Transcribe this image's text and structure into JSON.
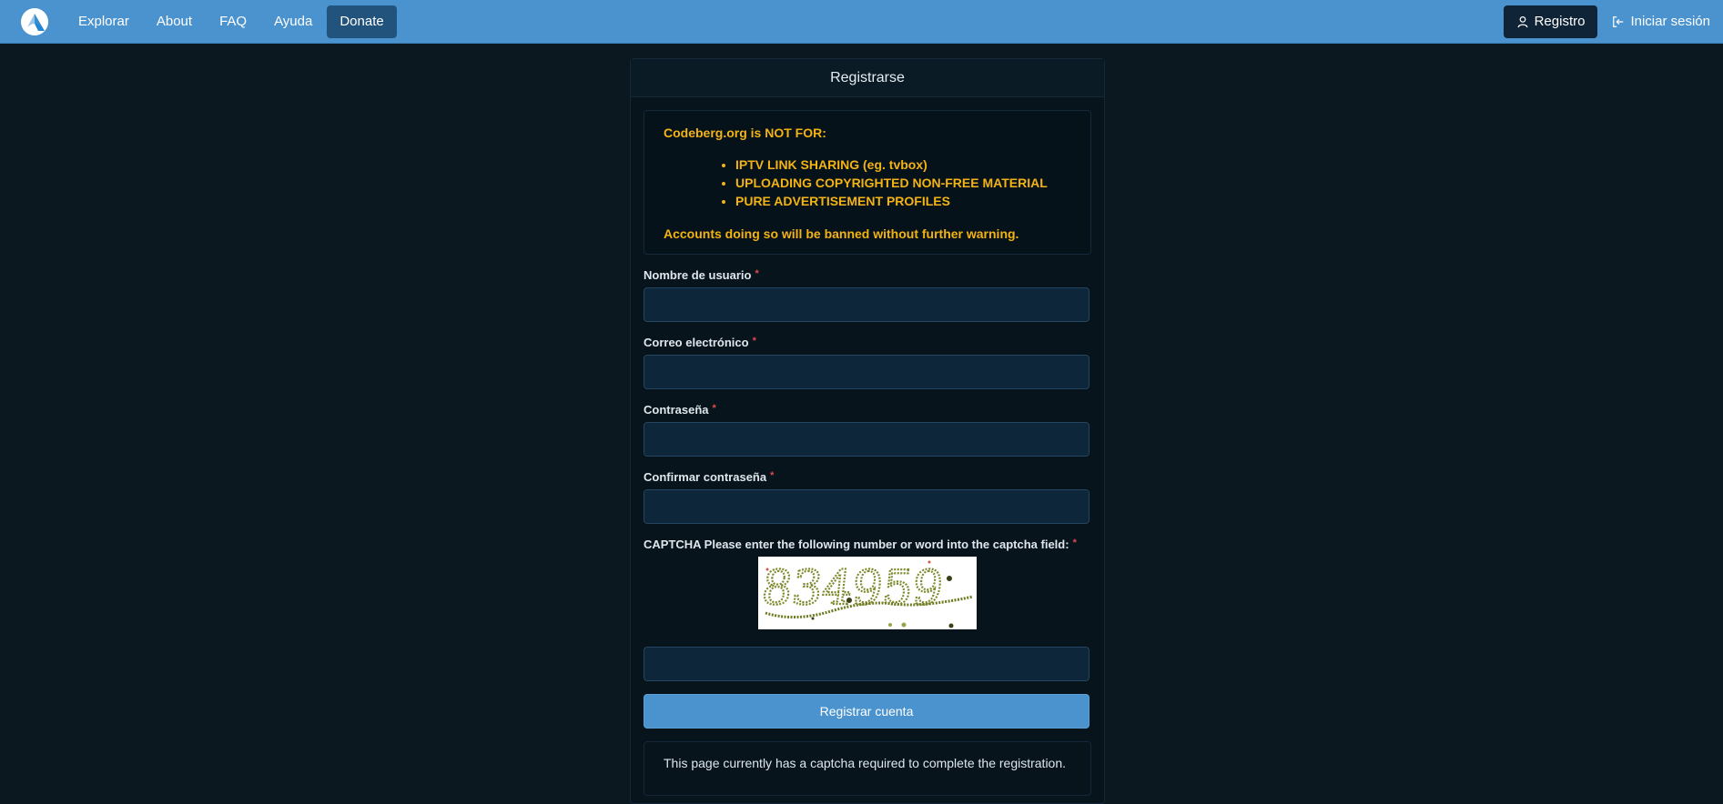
{
  "nav": {
    "logo_icon": "codeberg-mountain-icon",
    "items": [
      {
        "label": "Explorar"
      },
      {
        "label": "About"
      },
      {
        "label": "FAQ"
      },
      {
        "label": "Ayuda"
      },
      {
        "label": "Donate"
      }
    ],
    "register_label": "Registro",
    "signin_label": "Iniciar sesión",
    "accent_color": "#4a93cf"
  },
  "form": {
    "title": "Registrarse",
    "warning": {
      "title": "Codeberg.org is NOT FOR:",
      "items": [
        "IPTV LINK SHARING (eg. tvbox)",
        "UPLOADING COPYRIGHTED NON-FREE MATERIAL",
        "PURE ADVERTISEMENT PROFILES"
      ],
      "footer": "Accounts doing so will be banned without further warning.",
      "color": "#f4b314"
    },
    "username_label": "Nombre de usuario",
    "email_label": "Correo electrónico",
    "password_label": "Contraseña",
    "confirm_label": "Confirmar contraseña",
    "captcha_label": "CAPTCHA Please enter the following number or word into the captcha field:",
    "captcha_text": "834959",
    "required_mark": "*",
    "submit_label": "Registrar cuenta",
    "info_text": "This page currently has a captcha required to complete the registration."
  }
}
